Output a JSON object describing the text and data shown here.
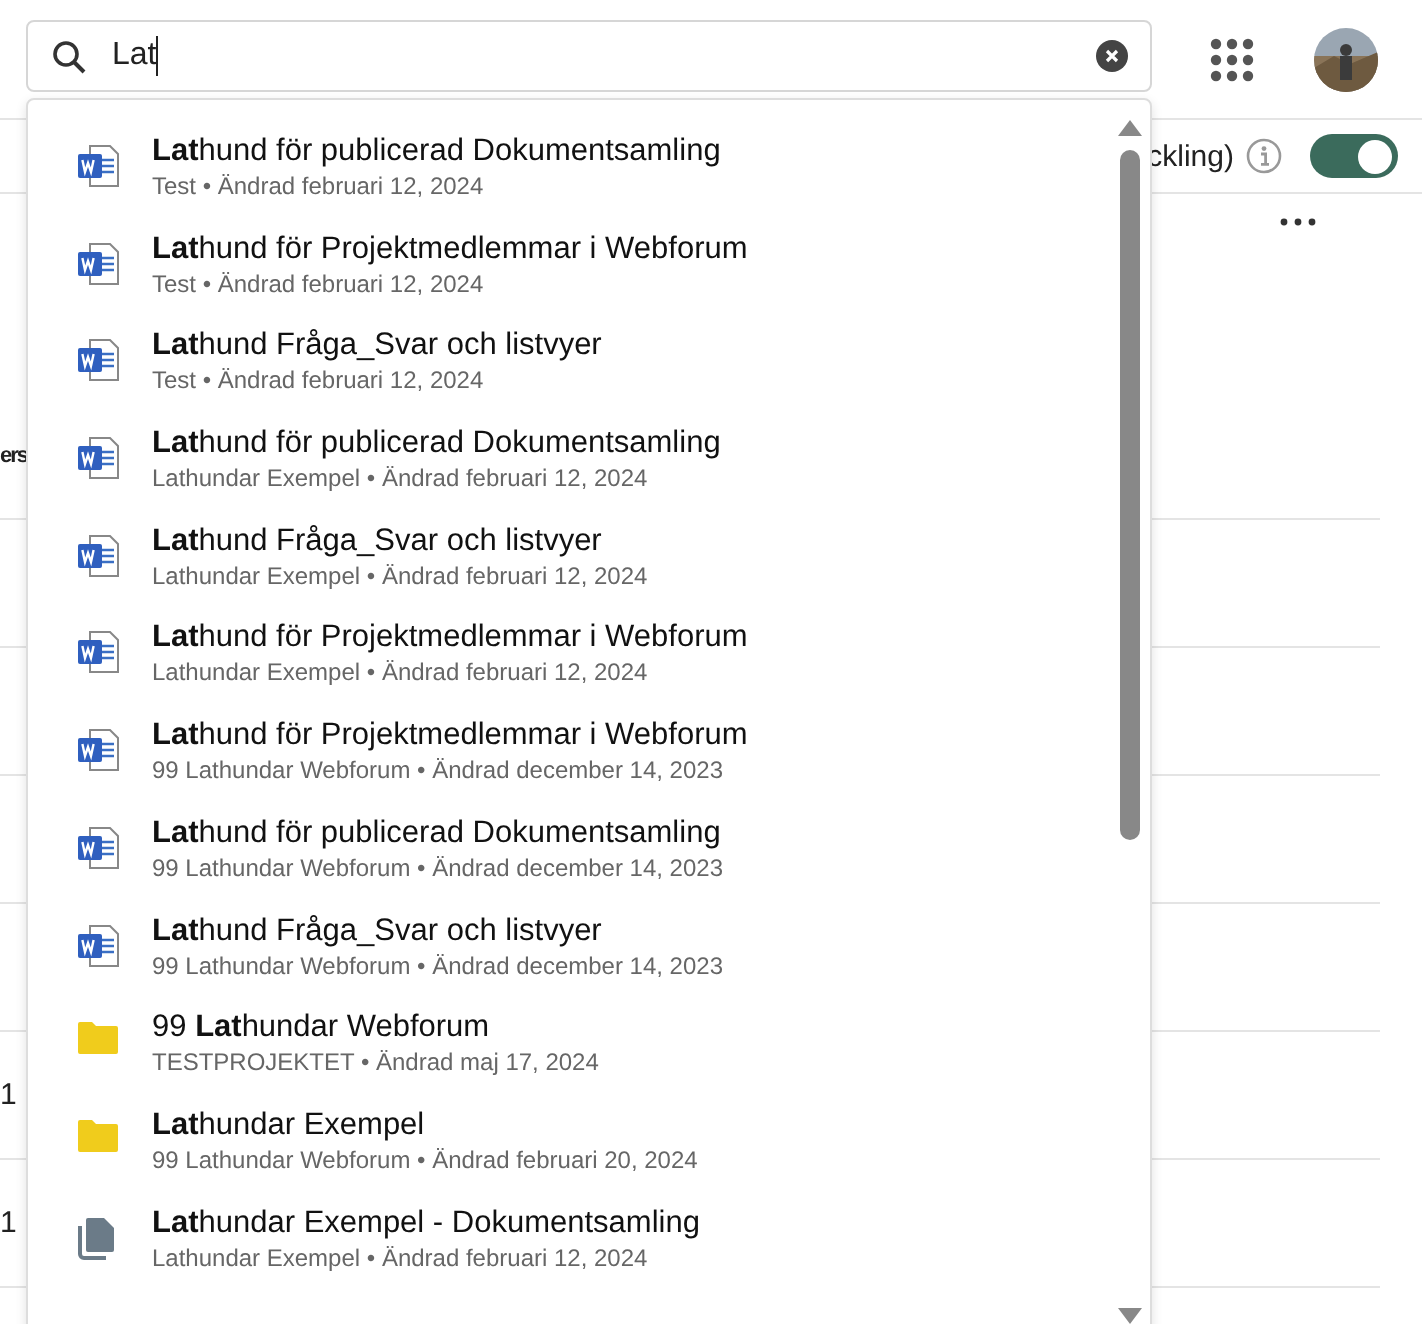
{
  "search": {
    "value": "Lat"
  },
  "toolbar": {
    "label": "ckling)",
    "toggle": {
      "on": true
    }
  },
  "table": {
    "rows": [
      {
        "cell": "ers"
      },
      {
        "cell": ""
      },
      {
        "cell": ""
      },
      {
        "cell": ""
      },
      {
        "cell": ""
      },
      {
        "cell": "1"
      },
      {
        "cell": "1"
      }
    ]
  },
  "results": [
    {
      "kind": "word",
      "title": "**Lat**hund för publicerad Dokumentsamling",
      "subtitle": "Test • Ändrad februari 12, 2024"
    },
    {
      "kind": "word",
      "title": "**Lat**hund för Projektmedlemmar i Webforum",
      "subtitle": "Test • Ändrad februari 12, 2024"
    },
    {
      "kind": "word",
      "title": "**Lat**hund Fråga_Svar och listvyer",
      "subtitle": "Test • Ändrad februari 12, 2024"
    },
    {
      "kind": "word",
      "title": "**Lat**hund för publicerad Dokumentsamling",
      "subtitle": "Lathundar Exempel • Ändrad februari 12, 2024"
    },
    {
      "kind": "word",
      "title": "**Lat**hund Fråga_Svar och listvyer",
      "subtitle": "Lathundar Exempel • Ändrad februari 12, 2024"
    },
    {
      "kind": "word",
      "title": "**Lat**hund för Projektmedlemmar i Webforum",
      "subtitle": "Lathundar Exempel • Ändrad februari 12, 2024"
    },
    {
      "kind": "word",
      "title": "**Lat**hund för Projektmedlemmar i Webforum",
      "subtitle": "99 Lathundar Webforum • Ändrad december 14, 2023"
    },
    {
      "kind": "word",
      "title": "**Lat**hund för publicerad Dokumentsamling",
      "subtitle": "99 Lathundar Webforum • Ändrad december 14, 2023"
    },
    {
      "kind": "word",
      "title": "**Lat**hund Fråga_Svar och listvyer",
      "subtitle": "99 Lathundar Webforum • Ändrad december 14, 2023"
    },
    {
      "kind": "folder",
      "title": "99 **Lat**hundar Webforum",
      "subtitle": "TESTPROJEKTET • Ändrad maj 17, 2024"
    },
    {
      "kind": "folder",
      "title": "**Lat**hundar Exempel",
      "subtitle": "99 Lathundar Webforum • Ändrad februari 20, 2024"
    },
    {
      "kind": "collection",
      "title": "**Lat**hundar Exempel - Dokumentsamling",
      "subtitle": "Lathundar Exempel • Ändrad februari 12, 2024"
    }
  ]
}
